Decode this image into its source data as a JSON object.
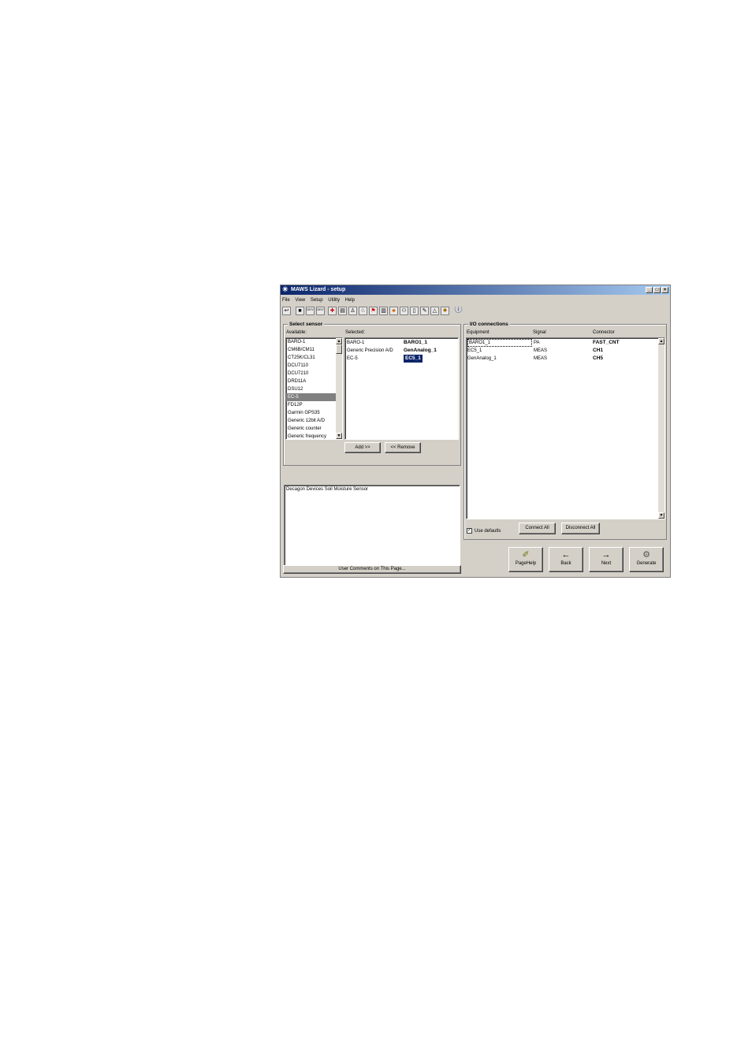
{
  "window": {
    "title": "MAWS Lizard - setup",
    "controls": [
      "_",
      "□",
      "×"
    ]
  },
  "menu": [
    "File",
    "View",
    "Setup",
    "Utility",
    "Help"
  ],
  "toolbar": {
    "icons": [
      "exit-icon",
      "stop-icon",
      "dev-icon",
      "dev2-icon",
      "plus-icon",
      "print-icon",
      "walk-icon",
      "run-icon",
      "flag-icon",
      "doc-icon",
      "tree-icon",
      "bike-icon",
      "page-icon",
      "pen-icon",
      "bell-icon",
      "gear-icon",
      "info-icon"
    ],
    "dev_label": "DEV"
  },
  "select_sensor": {
    "title": "Select sensor",
    "available_label": "Available:",
    "selected_label": "Selected:",
    "available": [
      "BARO-1",
      "CM6B/CM11",
      "CT25K/CL31",
      "DCU7110",
      "DCU7210",
      "DRD11A",
      "DSU12",
      "EC-5",
      "FD12P",
      "Garmin GPS35",
      "Generic 12bit A/D",
      "Generic counter",
      "Generic frequency"
    ],
    "selected_index": 7,
    "selected": [
      {
        "name": "BARO-1",
        "id": "BARO1_1"
      },
      {
        "name": "Generic Precision A/D",
        "id": "GenAnalog_1"
      },
      {
        "name": "EC-5",
        "id": "EC5_1"
      }
    ],
    "add_button": "Add >>",
    "remove_button": "<< Remove"
  },
  "description": {
    "text": "Decagon Devices Soil Moisture Sensor",
    "comments_button": "User Comments on This Page..."
  },
  "io_connections": {
    "title": "I/O connections",
    "headers": [
      "Equipment",
      "Signal",
      "Connector"
    ],
    "rows": [
      {
        "equipment": "BARO1_1",
        "signal": "PA",
        "connector": "FAST_CNT"
      },
      {
        "equipment": "EC5_1",
        "signal": "MEAS",
        "connector": "CH1"
      },
      {
        "equipment": "GenAnalog_1",
        "signal": "MEAS",
        "connector": "CH5"
      }
    ],
    "use_defaults_label": "Use defaults",
    "use_defaults_checked": true,
    "connect_all": "Connect All",
    "disconnect_all": "Disconnect All"
  },
  "nav": {
    "pagehelp": "PageHelp",
    "back": "Back",
    "next": "Next",
    "generate": "Generate"
  }
}
